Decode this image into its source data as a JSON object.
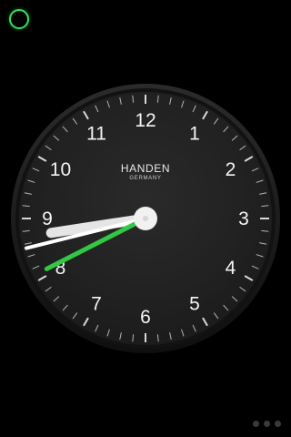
{
  "clock": {
    "brand": "HANDEN",
    "origin": "GERMANY",
    "numbers": [
      "12",
      "1",
      "2",
      "3",
      "4",
      "5",
      "6",
      "7",
      "8",
      "9",
      "10",
      "11"
    ],
    "time": {
      "hours": 8,
      "minutes": 42,
      "seconds": 40.5
    },
    "colors": {
      "face": "#232323",
      "bezel": "#161616",
      "numerals": "#f4f4f4",
      "hour_hand": "#e9e9e9",
      "minute_hand": "#ffffff",
      "second_hand": "#33c844",
      "accent_ring": "#2fe25a"
    }
  },
  "ui": {
    "icons": {
      "corner_indicator": "ring-icon",
      "pager": "page-dots-icon"
    },
    "pager": {
      "count": 3
    }
  }
}
